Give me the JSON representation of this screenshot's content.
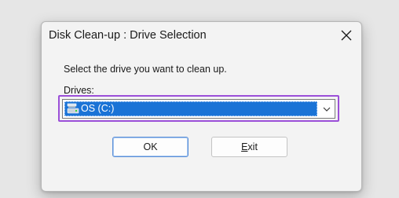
{
  "window": {
    "title": "Disk Clean-up : Drive Selection",
    "close_icon": "close-icon"
  },
  "instruction": "Select the drive you want to clean up.",
  "drives": {
    "label": "Drives:",
    "selected": "OS (C:)",
    "icon": "drive-icon",
    "highlight_color": "#9b4fd8",
    "selection_color": "#1a73d6"
  },
  "buttons": {
    "ok_label": "OK",
    "exit_label_first": "E",
    "exit_label_rest": "xit"
  }
}
